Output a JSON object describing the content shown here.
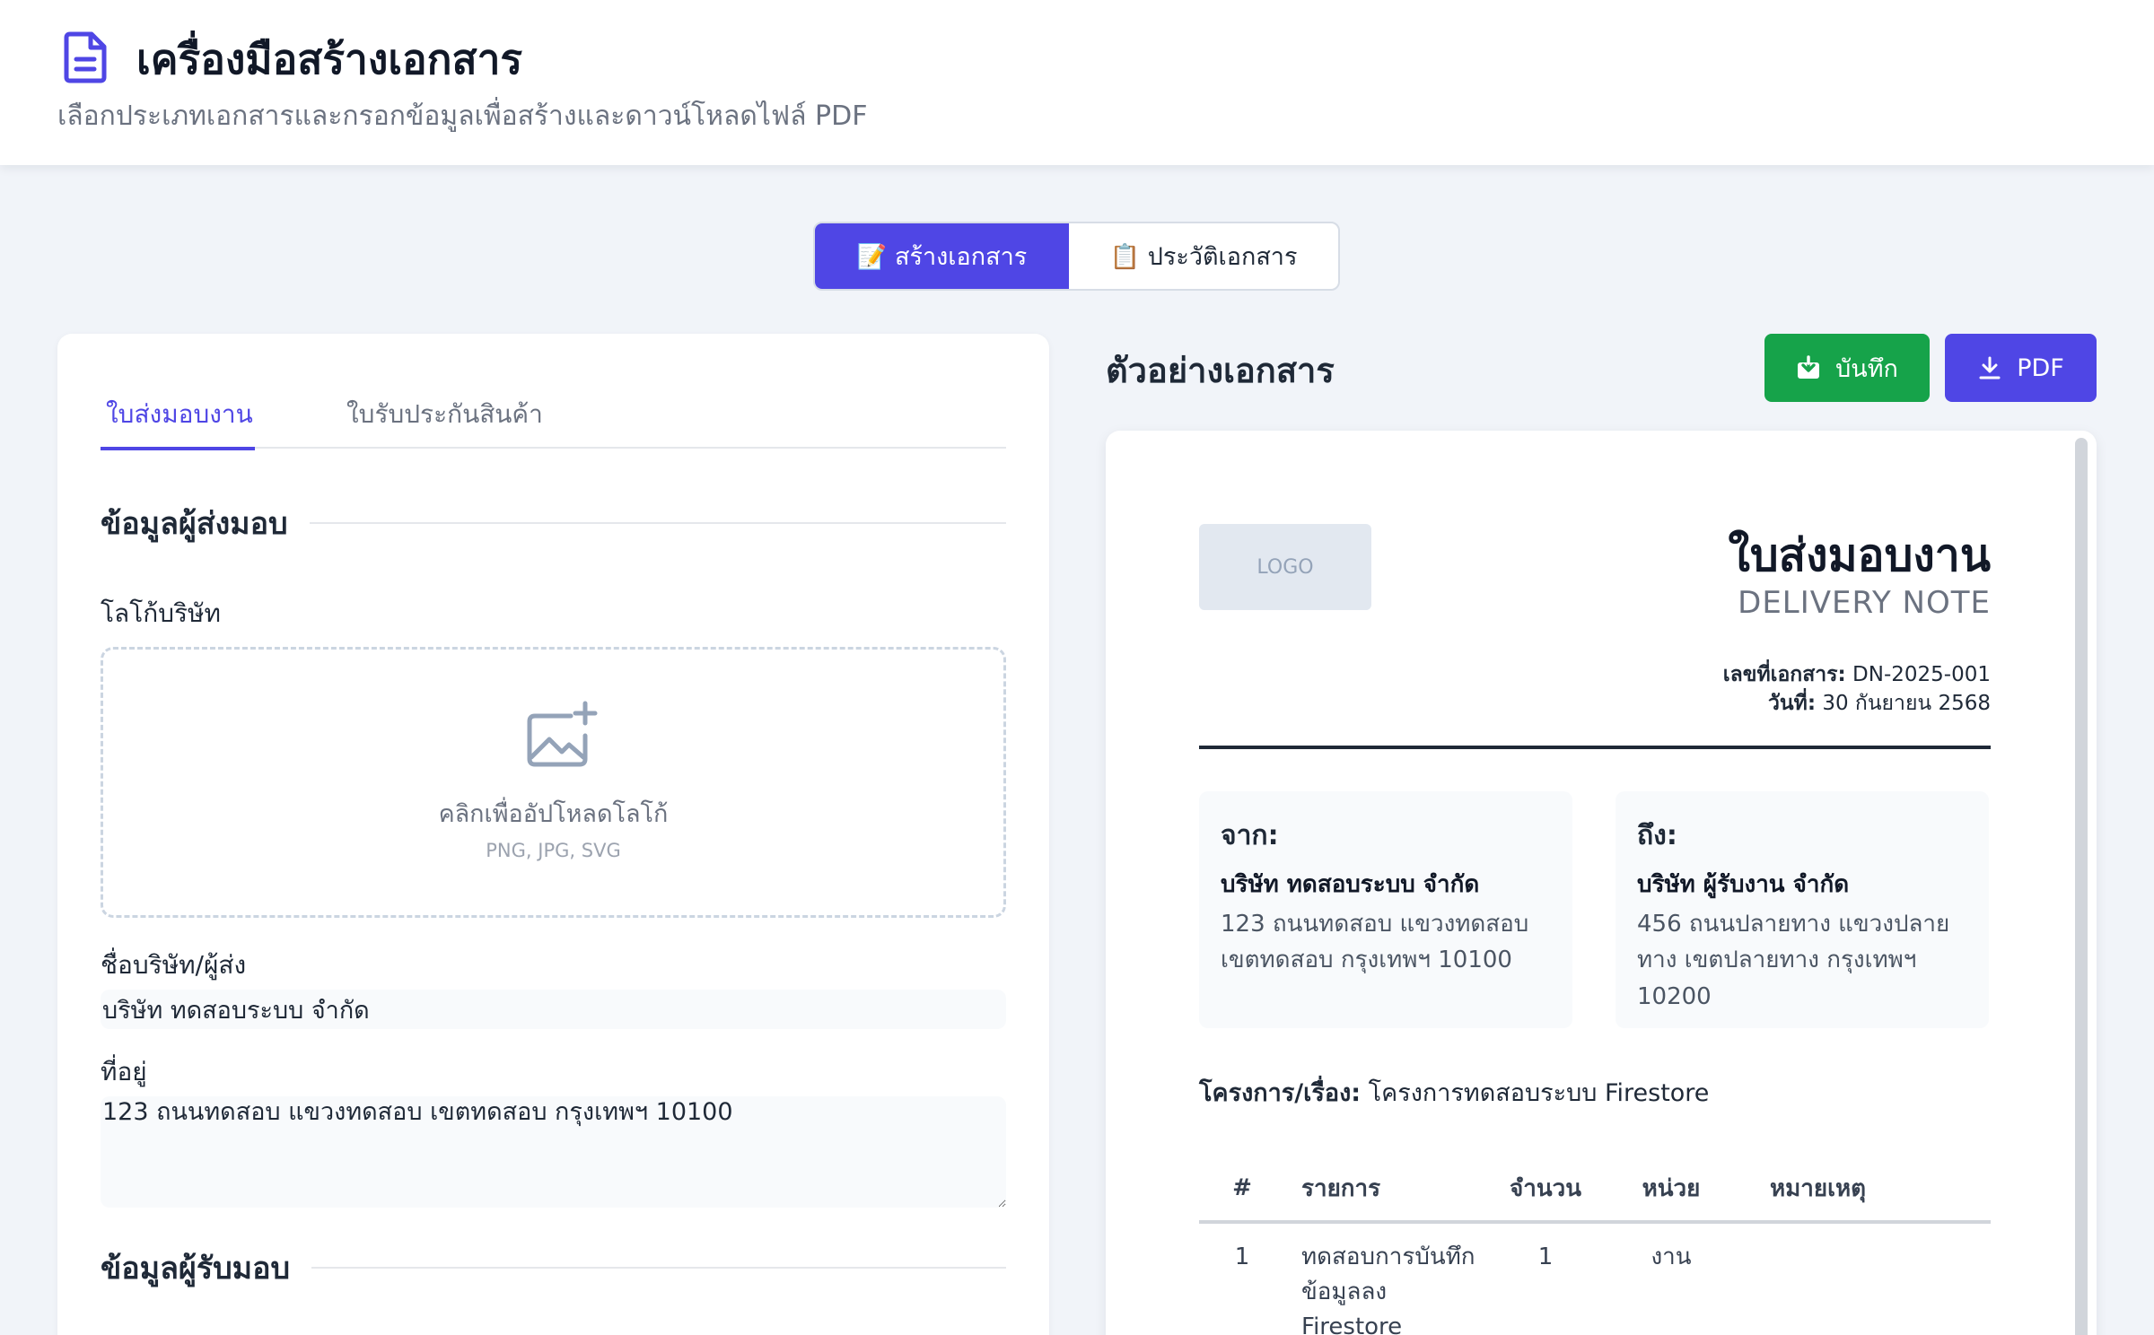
{
  "header": {
    "title": "เครื่องมือสร้างเอกสาร",
    "subtitle": "เลือกประเภทเอกสารและกรอกข้อมูลเพื่อสร้างและดาวน์โหลดไฟล์ PDF"
  },
  "main_tabs": [
    {
      "label": "📝 สร้างเอกสาร",
      "active": true
    },
    {
      "label": "📋 ประวัติเอกสาร",
      "active": false
    }
  ],
  "form": {
    "doc_tabs": [
      {
        "label": "ใบส่งมอบงาน",
        "active": true
      },
      {
        "label": "ใบรับประกันสินค้า",
        "active": false
      }
    ],
    "sender_section": "ข้อมูลผู้ส่งมอบ",
    "logo_label": "โลโก้บริษัท",
    "upload_text": "คลิกเพื่ออัปโหลดโลโก้",
    "upload_hint": "PNG, JPG, SVG",
    "company_label": "ชื่อบริษัท/ผู้ส่ง",
    "company_value": "บริษัท ทดสอบระบบ จำกัด",
    "address_label": "ที่อยู่",
    "address_value": "123 ถนนทดสอบ แขวงทดสอบ เขตทดสอบ กรุงเทพฯ 10100",
    "receiver_section": "ข้อมูลผู้รับมอบ"
  },
  "preview": {
    "title": "ตัวอย่างเอกสาร",
    "save_label": "บันทึก",
    "pdf_label": "PDF",
    "logo_placeholder": "LOGO",
    "doc_title": "ใบส่งมอบงาน",
    "doc_subtitle": "DELIVERY NOTE",
    "doc_no_label": "เลขที่เอกสาร:",
    "doc_no": "DN-2025-001",
    "date_label": "วันที่:",
    "date": "30 กันยายน 2568",
    "from": {
      "label": "จาก:",
      "name": "บริษัท ทดสอบระบบ จำกัด",
      "address": "123 ถนนทดสอบ แขวงทดสอบ เขตทดสอบ กรุงเทพฯ 10100"
    },
    "to": {
      "label": "ถึง:",
      "name": "บริษัท ผู้รับงาน จำกัด",
      "address": "456 ถนนปลายทาง แขวงปลายทาง เขตปลายทาง กรุงเทพฯ 10200"
    },
    "project_label": "โครงการ/เรื่อง:",
    "project": "โครงการทดสอบระบบ Firestore",
    "table": {
      "headers": [
        "#",
        "รายการ",
        "จำนวน",
        "หน่วย",
        "หมายเหตุ"
      ],
      "rows": [
        [
          "1",
          "ทดสอบการบันทึกข้อมูลลง Firestore",
          "1",
          "งาน",
          ""
        ]
      ]
    }
  },
  "colors": {
    "accent": "#4f46e5",
    "success": "#16a34a",
    "background": "#f1f4f9"
  },
  "icons": {
    "header": "document-icon",
    "upload": "image-add-icon",
    "save": "save-icon",
    "pdf": "download-icon"
  }
}
